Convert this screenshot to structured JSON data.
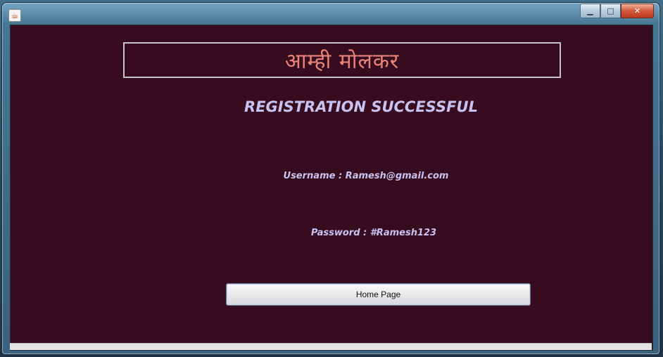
{
  "window": {
    "title": "",
    "controls": {
      "minimize": "▁",
      "maximize": "□",
      "close": "✕"
    }
  },
  "app": {
    "icon": "java-icon",
    "header": "आम्ही मोलकर",
    "registration_title": "REGISTRATION SUCCESSFUL",
    "username_line": "Username : Ramesh@gmail.com",
    "password_line": "Password : #Ramesh123",
    "home_button": "Home Page"
  },
  "colors": {
    "background": "#360c1e",
    "header_text": "#e8847a",
    "label_text": "#c8c2f2"
  }
}
